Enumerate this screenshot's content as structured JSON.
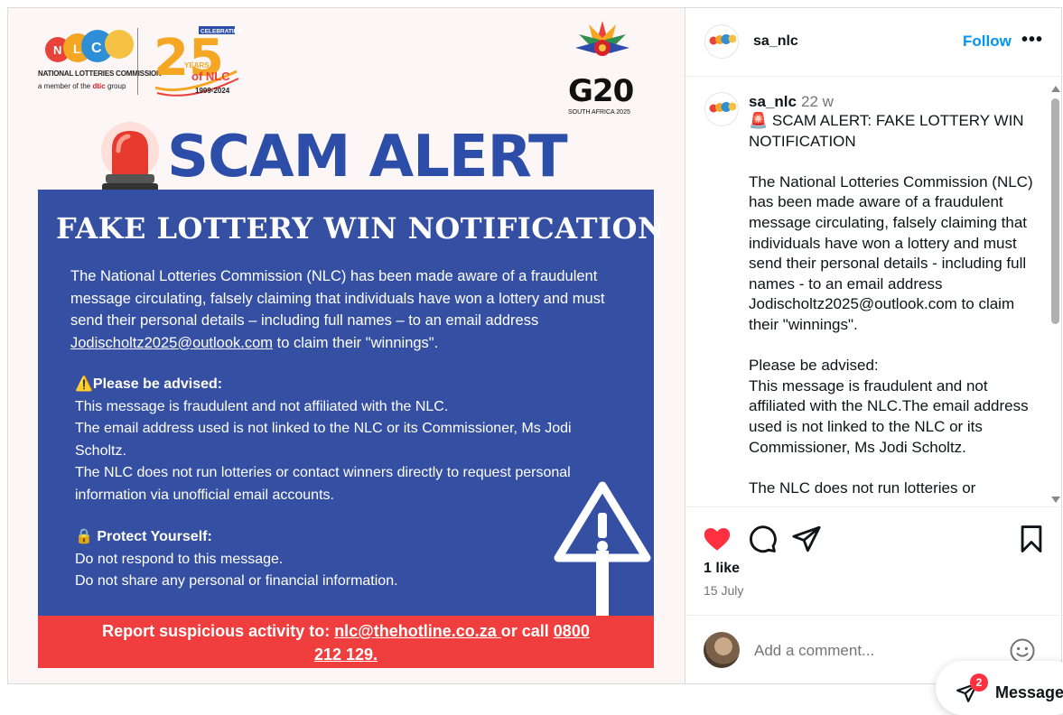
{
  "post_image": {
    "nlc_logo": {
      "letters": [
        "N",
        "L",
        "C"
      ],
      "name": "NATIONAL LOTTERIES COMMISSION",
      "member_prefix": "a member of the ",
      "member_org": "dtic",
      "member_suffix": " group"
    },
    "anniversary": {
      "celebrating": "CELEBRATING",
      "number": "25",
      "years": "YEARS",
      "of_nlc": "of NLC",
      "range": "1999-2024"
    },
    "g20": {
      "title": "G20",
      "subtitle": "SOUTH AFRICA 2025"
    },
    "alert_title": "SCAM ALERT",
    "panel": {
      "heading": "FAKE LOTTERY WIN NOTIFICATION",
      "intro_before": "The National Lotteries Commission (NLC) has been made aware of a fraudulent message circulating, falsely claiming that individuals have won a lottery and must send their personal details – including full names – to an email address ",
      "intro_email": "Jodischoltz2025@outlook.com",
      "intro_after": " to claim their \"winnings\".",
      "advised_heading": "⚠️Please be advised:",
      "advised_lines": [
        "This message is fraudulent and not affiliated with the NLC.",
        "The email address used is not linked to the NLC or its Commissioner, Ms Jodi Scholtz.",
        "The NLC does not run lotteries or contact winners directly to request personal information via unofficial email accounts."
      ],
      "protect_heading": "🔒 Protect Yourself:",
      "protect_lines": [
        "Do not respond to this message.",
        "Do not share any personal or financial information."
      ]
    },
    "report": {
      "prefix": "Report suspicious activity to: ",
      "email": "nlc@thehotline.co.za ",
      "middle": "or call ",
      "phone_a": "0800",
      "phone_b": "212 129."
    }
  },
  "header": {
    "username": "sa_nlc",
    "follow_label": "Follow",
    "more_label": "•••"
  },
  "caption": {
    "username": "sa_nlc",
    "time": "22 w",
    "text": "🚨 SCAM ALERT: FAKE LOTTERY WIN NOTIFICATION\n\nThe National Lotteries Commission (NLC) has been made aware of a fraudulent message circulating, falsely claiming that individuals have won a lottery and must send their personal details - including full names - to an email address Jodischoltz2025@outlook.com to claim their \"winnings\".\n\nPlease be advised:\nThis message is fraudulent and not affiliated with the NLC.The email address used is not linked to the NLC or its Commissioner, Ms Jodi Scholtz.\n\nThe NLC does not run lotteries or"
  },
  "engagement": {
    "likes": "1 like",
    "date": "15 July",
    "liked": true,
    "like_color": "#ff3040"
  },
  "comment": {
    "placeholder": "Add a comment..."
  },
  "messages": {
    "badge": "2",
    "label": "Messages"
  },
  "colors": {
    "accent": "#0095f6",
    "panel_blue": "#3550a3",
    "alert_red": "#f03e3e",
    "title_blue": "#2d4ea8"
  },
  "icons": [
    "heart-icon",
    "comment-icon",
    "share-icon",
    "bookmark-icon",
    "emoji-icon",
    "messages-icon",
    "siren-icon",
    "warning-sign-icon"
  ]
}
